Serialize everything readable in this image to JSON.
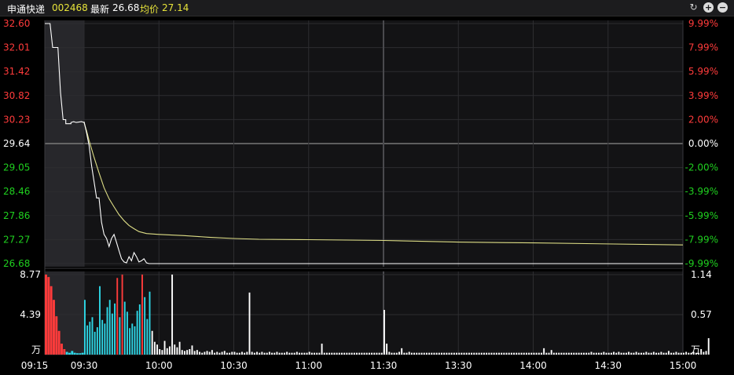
{
  "header": {
    "stock_name": "申通快递",
    "stock_code": "002468",
    "latest_label": "最新",
    "latest_value": "26.68",
    "avg_label": "均价",
    "avg_value": "27.14",
    "icons": [
      "refresh-icon",
      "zoom-in-icon",
      "zoom-out-icon"
    ]
  },
  "colors": {
    "up": "#ff3b3b",
    "down": "#1fd01f",
    "neutral": "#ffffff",
    "avg_line": "#dede86",
    "price_line": "#ffffff",
    "volume_up": "#ff3b3b",
    "volume_down": "#2ed7e6",
    "grid": "#2d2d30",
    "background": "#131315",
    "auction_shade": "#27272b"
  },
  "chart_data": [
    {
      "type": "line",
      "x_ticks": [
        "09:15",
        "09:30",
        "10:00",
        "10:30",
        "11:00",
        "11:30",
        "13:30",
        "14:00",
        "14:30",
        "15:00"
      ],
      "y_ticks": [
        "32.60",
        "32.01",
        "31.42",
        "30.82",
        "30.23",
        "29.64",
        "29.05",
        "28.46",
        "27.86",
        "27.27",
        "26.68"
      ],
      "y2_ticks": [
        "9.99%",
        "7.99%",
        "5.99%",
        "3.99%",
        "2.00%",
        "0.00%",
        "-2.00%",
        "-3.99%",
        "-5.99%",
        "-7.99%",
        "-9.99%"
      ],
      "ylim": [
        26.68,
        32.6
      ],
      "prev_close": 29.64,
      "series": [
        {
          "x": [
            "09:15",
            "09:17",
            "09:18",
            "09:20",
            "09:21",
            "09:22",
            "09:23",
            "09:23",
            "09:25",
            "09:25",
            "09:26",
            "09:27",
            "09:29",
            "09:30"
          ],
          "values": [
            32.6,
            32.6,
            32.01,
            32.01,
            30.9,
            30.23,
            30.23,
            30.13,
            30.13,
            30.16,
            30.18,
            30.16,
            30.18,
            30.16
          ]
        },
        {
          "x": [
            "09:30",
            "09:31",
            "09:32",
            "09:33",
            "09:34",
            "09:35",
            "09:36",
            "09:37",
            "09:38",
            "09:39",
            "09:40",
            "09:41",
            "09:42",
            "09:43",
            "09:44",
            "09:45",
            "09:46",
            "09:47",
            "09:48",
            "09:49",
            "09:50",
            "09:51",
            "09:52",
            "09:53",
            "09:54",
            "09:55",
            "09:56",
            "09:57",
            "09:58",
            "10:00",
            "10:10",
            "10:30",
            "11:00",
            "11:30",
            "13:00",
            "14:00",
            "15:00"
          ],
          "values": [
            30.18,
            29.9,
            29.6,
            29.1,
            28.7,
            28.3,
            28.3,
            27.7,
            27.4,
            27.3,
            27.1,
            27.3,
            27.4,
            27.2,
            27.0,
            26.8,
            26.72,
            26.7,
            26.85,
            26.75,
            26.95,
            26.85,
            26.72,
            26.75,
            26.8,
            26.7,
            26.68,
            26.68,
            26.68,
            26.68,
            26.68,
            26.68,
            26.68,
            26.68,
            26.68,
            26.68,
            26.68
          ]
        },
        {
          "x": [
            "09:30",
            "09:31",
            "09:32",
            "09:34",
            "09:36",
            "09:38",
            "09:40",
            "09:42",
            "09:44",
            "09:46",
            "09:48",
            "09:50",
            "09:52",
            "09:55",
            "10:00",
            "10:10",
            "10:20",
            "10:30",
            "10:40",
            "11:00",
            "11:30",
            "13:30",
            "14:00",
            "15:00"
          ],
          "values": [
            30.16,
            29.95,
            29.72,
            29.3,
            28.92,
            28.55,
            28.28,
            28.08,
            27.89,
            27.74,
            27.62,
            27.54,
            27.47,
            27.42,
            27.4,
            27.37,
            27.33,
            27.3,
            27.28,
            27.27,
            27.25,
            27.21,
            27.19,
            27.14
          ]
        }
      ]
    },
    {
      "type": "bar",
      "y_ticks": [
        "8.77",
        "4.39",
        "万"
      ],
      "y2_ticks": [
        "1.14",
        "0.57",
        "万"
      ],
      "ylim": [
        0,
        8.77
      ],
      "auction": [
        {
          "x": "09:15",
          "value": 8.77,
          "dir": "up"
        },
        {
          "x": "09:16",
          "value": 8.5,
          "dir": "up"
        },
        {
          "x": "09:17",
          "value": 7.5,
          "dir": "up"
        },
        {
          "x": "09:18",
          "value": 6.0,
          "dir": "up"
        },
        {
          "x": "09:19",
          "value": 4.2,
          "dir": "up"
        },
        {
          "x": "09:20",
          "value": 2.6,
          "dir": "up"
        },
        {
          "x": "09:21",
          "value": 1.2,
          "dir": "up"
        },
        {
          "x": "09:22",
          "value": 0.6,
          "dir": "up"
        },
        {
          "x": "09:23",
          "value": 0.3,
          "dir": "down"
        },
        {
          "x": "09:24",
          "value": 0.2,
          "dir": "down"
        },
        {
          "x": "09:25",
          "value": 0.4,
          "dir": "down"
        },
        {
          "x": "09:26",
          "value": 0.2,
          "dir": "down"
        },
        {
          "x": "09:27",
          "value": 0.15,
          "dir": "down"
        },
        {
          "x": "09:28",
          "value": 0.15,
          "dir": "down"
        },
        {
          "x": "09:29",
          "value": 0.2,
          "dir": "down"
        }
      ],
      "minute_values": [
        6.0,
        3.2,
        3.6,
        4.1,
        2.5,
        3.0,
        7.5,
        3.8,
        3.4,
        5.2,
        6.0,
        4.5,
        5.6,
        8.4,
        4.1,
        8.77,
        5.8,
        4.7,
        2.9,
        3.4,
        3.1,
        4.8,
        5.5,
        8.77,
        6.3,
        3.9,
        6.9,
        2.6,
        1.4,
        1.1,
        0.6,
        0.5,
        1.5,
        0.7,
        0.9,
        8.77,
        1.1,
        0.8,
        1.4,
        0.5,
        0.4,
        0.5,
        0.6,
        1.0,
        0.4,
        0.5,
        0.3,
        0.2,
        0.3,
        0.4,
        0.3,
        0.5,
        0.2,
        0.3,
        0.2,
        0.3,
        0.4,
        0.2,
        0.2,
        0.3,
        0.3,
        0.2,
        0.2,
        0.3,
        0.2,
        0.3,
        6.8,
        0.3,
        0.2,
        0.3,
        0.2,
        0.3,
        0.2,
        0.2,
        0.3,
        0.2,
        0.2,
        0.3,
        0.2,
        0.2,
        0.2,
        0.3,
        0.2,
        0.2,
        0.2,
        0.3,
        0.2,
        0.2,
        0.2,
        0.2,
        0.3,
        0.2,
        0.2,
        0.2,
        0.2,
        1.2,
        0.2,
        0.2,
        0.2,
        0.2,
        0.2,
        0.2,
        0.2,
        0.2,
        0.2,
        0.2,
        0.2,
        0.2,
        0.2,
        0.2,
        0.2,
        0.2,
        0.2,
        0.2,
        0.2,
        0.2,
        0.2,
        0.2,
        0.2,
        0.2,
        4.9,
        1.2,
        0.3,
        0.2,
        0.2,
        0.2,
        0.3,
        0.7,
        0.2,
        0.2,
        0.3,
        0.2,
        0.2,
        0.2,
        0.2,
        0.2,
        0.2,
        0.2,
        0.2,
        0.2,
        0.2,
        0.2,
        0.2,
        0.2,
        0.2,
        0.2,
        0.2,
        0.2,
        0.2,
        0.2,
        0.2,
        0.2,
        0.2,
        0.2,
        0.2,
        0.2,
        0.2,
        0.2,
        0.2,
        0.2,
        0.2,
        0.2,
        0.2,
        0.2,
        0.2,
        0.2,
        0.2,
        0.2,
        0.2,
        0.2,
        0.2,
        0.2,
        0.2,
        0.2,
        0.2,
        0.2,
        0.2,
        0.2,
        0.2,
        0.2,
        0.2,
        0.2,
        0.2,
        0.2,
        0.7,
        0.2,
        0.2,
        0.5,
        0.2,
        0.2,
        0.2,
        0.2,
        0.2,
        0.2,
        0.2,
        0.2,
        0.2,
        0.2,
        0.2,
        0.2,
        0.2,
        0.2,
        0.2,
        0.3,
        0.2,
        0.2,
        0.2,
        0.2,
        0.3,
        0.2,
        0.2,
        0.2,
        0.3,
        0.2,
        0.3,
        0.2,
        0.2,
        0.2,
        0.3,
        0.2,
        0.2,
        0.3,
        0.2,
        0.2,
        0.2,
        0.3,
        0.2,
        0.2,
        0.3,
        0.2,
        0.2,
        0.3,
        0.2,
        0.2,
        0.4,
        0.2,
        0.2,
        0.3,
        0.2,
        0.2,
        0.2,
        0.3,
        0.2,
        0.2,
        0.3,
        0.2,
        0.2,
        0.6,
        0.3,
        0.4,
        1.8
      ],
      "minute_dirs": [
        "down",
        "down",
        "down",
        "down",
        "down",
        "down",
        "down",
        "down",
        "down",
        "down",
        "down",
        "down",
        "down",
        "up",
        "down",
        "up",
        "down",
        "down",
        "down",
        "down",
        "down",
        "down",
        "down",
        "up",
        "down",
        "down",
        "down",
        "neutral",
        "neutral",
        "neutral"
      ]
    }
  ]
}
